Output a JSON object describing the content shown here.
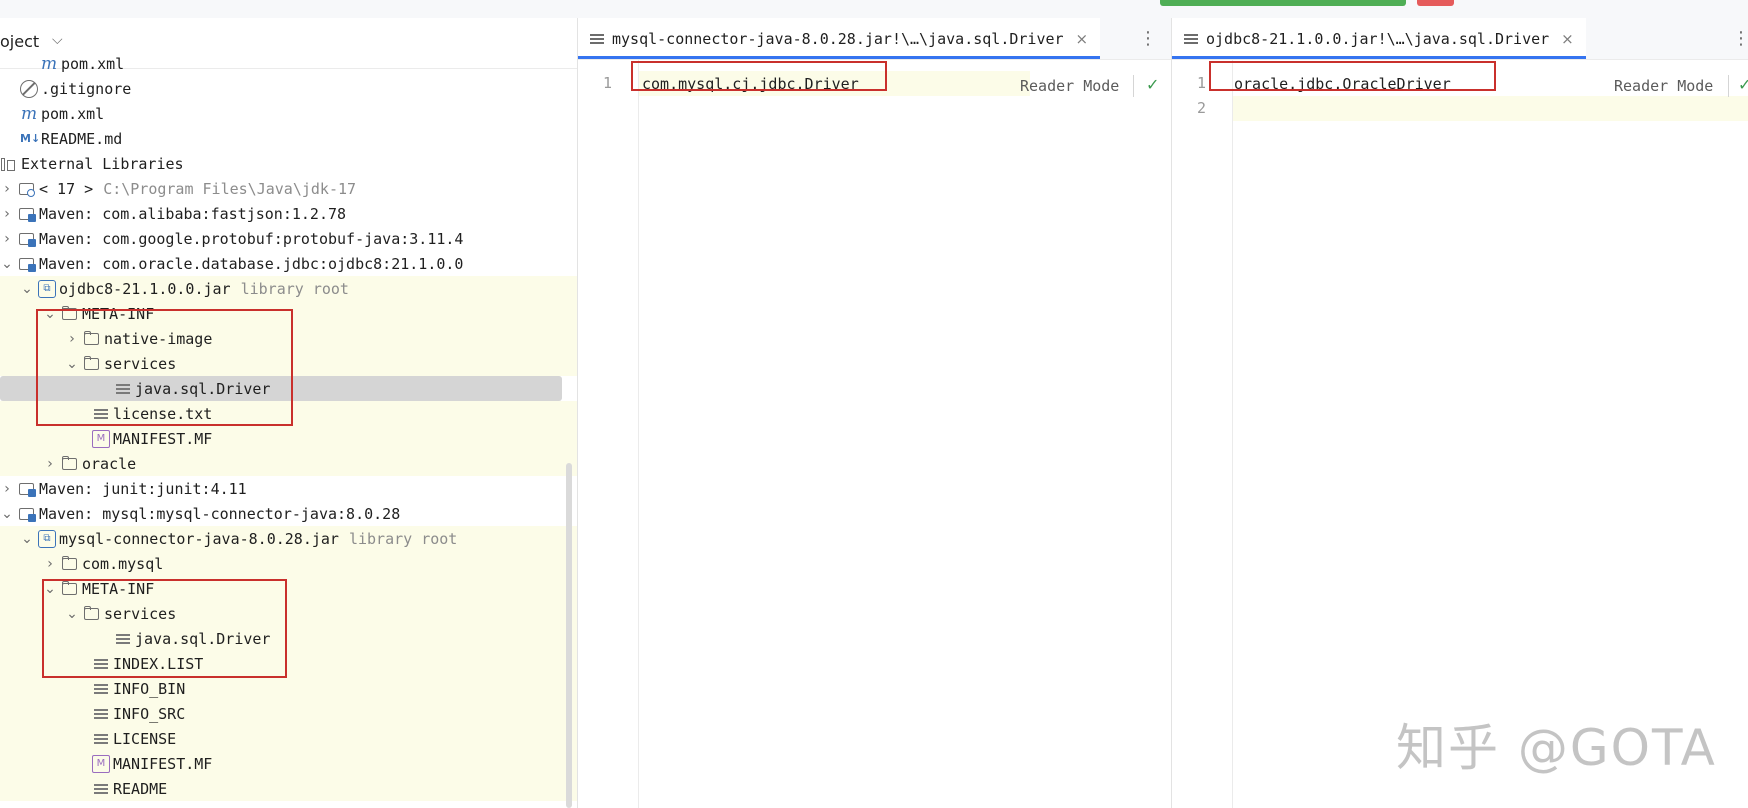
{
  "project_panel": {
    "title": "oject",
    "tree": [
      {
        "label": "pom.xml",
        "icon": "maven-icon"
      },
      {
        "label": ".gitignore",
        "icon": "gitignore-icon"
      },
      {
        "label": "pom.xml",
        "icon": "maven-icon"
      },
      {
        "label": "README.md",
        "icon": "markdown-icon"
      },
      {
        "label": "External Libraries",
        "icon": "external-libraries-icon"
      },
      {
        "label": "< 17 >",
        "hint": "C:\\Program Files\\Java\\jdk-17",
        "icon": "jdk-icon"
      },
      {
        "label": "Maven: com.alibaba:fastjson:1.2.78",
        "icon": "library-icon"
      },
      {
        "label": "Maven: com.google.protobuf:protobuf-java:3.11.4",
        "icon": "library-icon"
      },
      {
        "label": "Maven: com.oracle.database.jdbc:ojdbc8:21.1.0.0",
        "icon": "library-icon"
      },
      {
        "label": "ojdbc8-21.1.0.0.jar",
        "hint": "library root",
        "icon": "jar-icon"
      },
      {
        "label": "META-INF",
        "icon": "folder-icon"
      },
      {
        "label": "native-image",
        "icon": "folder-icon"
      },
      {
        "label": "services",
        "icon": "folder-icon"
      },
      {
        "label": "java.sql.Driver",
        "icon": "text-file-icon"
      },
      {
        "label": "license.txt",
        "icon": "text-file-icon"
      },
      {
        "label": "MANIFEST.MF",
        "icon": "manifest-icon"
      },
      {
        "label": "oracle",
        "icon": "folder-icon"
      },
      {
        "label": "Maven: junit:junit:4.11",
        "icon": "library-icon"
      },
      {
        "label": "Maven: mysql:mysql-connector-java:8.0.28",
        "icon": "library-icon"
      },
      {
        "label": "mysql-connector-java-8.0.28.jar",
        "hint": "library root",
        "icon": "jar-icon"
      },
      {
        "label": "com.mysql",
        "icon": "folder-icon"
      },
      {
        "label": "META-INF",
        "icon": "folder-icon"
      },
      {
        "label": "services",
        "icon": "folder-icon"
      },
      {
        "label": "java.sql.Driver",
        "icon": "text-file-icon"
      },
      {
        "label": "INDEX.LIST",
        "icon": "text-file-icon"
      },
      {
        "label": "INFO_BIN",
        "icon": "text-file-icon"
      },
      {
        "label": "INFO_SRC",
        "icon": "text-file-icon"
      },
      {
        "label": "LICENSE",
        "icon": "text-file-icon"
      },
      {
        "label": "MANIFEST.MF",
        "icon": "manifest-icon"
      },
      {
        "label": "README",
        "icon": "text-file-icon"
      }
    ]
  },
  "editor_left": {
    "tab_title": "mysql-connector-java-8.0.28.jar!\\…\\java.sql.Driver",
    "line_numbers": [
      "1"
    ],
    "lines": [
      "com.mysql.cj.jdbc.Driver"
    ],
    "reader_mode": "Reader Mode"
  },
  "editor_right": {
    "tab_title": "ojdbc8-21.1.0.0.jar!\\…\\java.sql.Driver",
    "line_numbers": [
      "1",
      "2"
    ],
    "lines": [
      "oracle.jdbc.OracleDriver",
      ""
    ],
    "reader_mode": "Reader Mode"
  },
  "icons": {
    "close": "×",
    "menu": "⋮",
    "check": "✓",
    "chevron_down": "⌵",
    "arrow_right": "›",
    "arrow_down": "⌄"
  },
  "colors": {
    "highlight_row": "#fcfce8",
    "selection": "#d5d5d5",
    "annotation_box": "#c9302c",
    "tab_underline": "#3574f0"
  },
  "watermark": "知乎 @GOTA"
}
